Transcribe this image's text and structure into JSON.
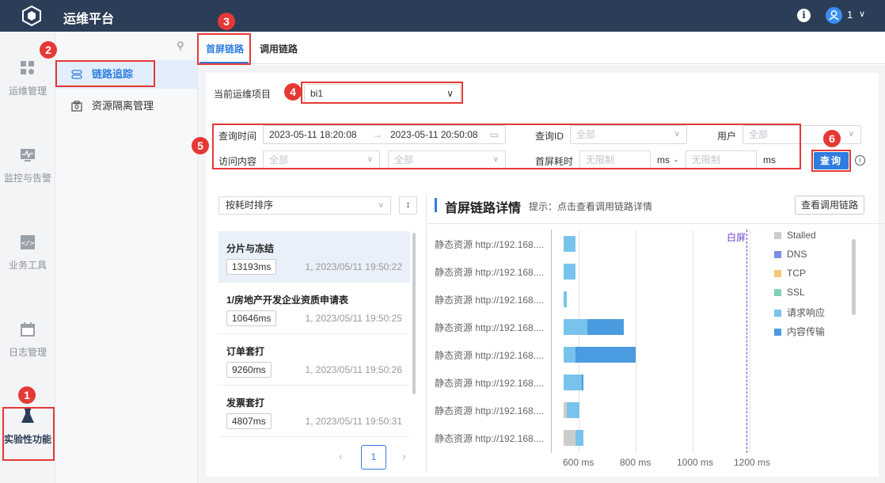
{
  "app": {
    "title": "运维平台",
    "user": "1",
    "info_icon": "info-icon"
  },
  "rail": {
    "items": [
      {
        "label": "运维管理",
        "icon": "grid-icon"
      },
      {
        "label": "监控与告警",
        "icon": "monitor-icon"
      },
      {
        "label": "业务工具",
        "icon": "code-icon"
      },
      {
        "label": "日志管理",
        "icon": "calendar-icon"
      },
      {
        "label": "实验性功能",
        "icon": "flask-icon"
      }
    ]
  },
  "submenu": {
    "items": [
      {
        "label": "链路追踪",
        "active": true
      },
      {
        "label": "资源隔离管理",
        "active": false
      }
    ]
  },
  "tabs": [
    {
      "label": "首屏链路",
      "active": true
    },
    {
      "label": "调用链路",
      "active": false
    }
  ],
  "project": {
    "label": "当前运维项目",
    "value": "bi1"
  },
  "filters": {
    "time_label": "查询时间",
    "time_start": "2023-05-11 18:20:08",
    "time_arrow": "→",
    "time_end": "2023-05-11 20:50:08",
    "id_label": "查询ID",
    "id_value": "全部",
    "user_label": "用户",
    "user_value": "全部",
    "visit_label": "访问内容",
    "visit_value1": "全部",
    "visit_value2": "全部",
    "fst_label": "首屏耗时",
    "fst_min_placeholder": "无限制",
    "fst_max_placeholder": "无限制",
    "unit1": "ms",
    "dash": "-",
    "unit2": "ms",
    "query_button": "查询"
  },
  "badges": [
    "1",
    "2",
    "3",
    "4",
    "5",
    "6"
  ],
  "sort": {
    "label": "按耗时排序"
  },
  "records": [
    {
      "name": "分片与冻结",
      "ms": "13193ms",
      "time": "1, 2023/05/11 19:50:22",
      "selected": true
    },
    {
      "name": "1/房地产开发企业资质申请表",
      "ms": "10646ms",
      "time": "1, 2023/05/11 19:50:25",
      "selected": false
    },
    {
      "name": "订单套打",
      "ms": "9260ms",
      "time": "1, 2023/05/11 19:50:26",
      "selected": false
    },
    {
      "name": "发票套打",
      "ms": "4807ms",
      "time": "1, 2023/05/11 19:50:31",
      "selected": false
    }
  ],
  "pagination": {
    "current": "1",
    "prev": "‹",
    "next": "›"
  },
  "detail": {
    "title": "首屏链路详情",
    "hint": "提示：点击查看调用链路详情",
    "view_button": "查看调用链路",
    "white_screen_label": "白屏",
    "resource_label": "静态资源 http://192.168....",
    "legend": [
      {
        "name": "Stalled",
        "color": "#cccccc"
      },
      {
        "name": "DNS",
        "color": "#7b8fe3"
      },
      {
        "name": "TCP",
        "color": "#f3c77a"
      },
      {
        "name": "SSL",
        "color": "#7fd3b0"
      },
      {
        "name": "请求响应",
        "color": "#78c3ec"
      },
      {
        "name": "内容传输",
        "color": "#4a9be0"
      }
    ],
    "x_ticks": [
      "600 ms",
      "800 ms",
      "1000 ms",
      "1200 ms"
    ]
  },
  "chart_data": {
    "type": "bar",
    "categories": [
      "静态资源 http://192.168....",
      "静态资源 http://192.168....",
      "静态资源 http://192.168....",
      "静态资源 http://192.168....",
      "静态资源 http://192.168....",
      "静态资源 http://192.168....",
      "静态资源 http://192.168....",
      "静态资源 http://192.168...."
    ],
    "x_ticks_ms": [
      600,
      800,
      1000,
      1200
    ],
    "white_screen_ms": 1190,
    "segments": [
      [
        {
          "phase": "请求响应",
          "start": 548,
          "end": 590
        }
      ],
      [
        {
          "phase": "请求响应",
          "start": 548,
          "end": 590
        }
      ],
      [
        {
          "phase": "请求响应",
          "start": 548,
          "end": 558
        }
      ],
      [
        {
          "phase": "请求响应",
          "start": 548,
          "end": 630
        },
        {
          "phase": "内容传输",
          "start": 630,
          "end": 758
        }
      ],
      [
        {
          "phase": "请求响应",
          "start": 548,
          "end": 590
        },
        {
          "phase": "内容传输",
          "start": 590,
          "end": 800
        }
      ],
      [
        {
          "phase": "请求响应",
          "start": 548,
          "end": 611
        },
        {
          "phase": "内容传输",
          "start": 611,
          "end": 614
        }
      ],
      [
        {
          "phase": "Stalled",
          "start": 548,
          "end": 558
        },
        {
          "phase": "请求响应",
          "start": 558,
          "end": 604
        }
      ],
      [
        {
          "phase": "Stalled",
          "start": 548,
          "end": 590
        },
        {
          "phase": "请求响应",
          "start": 590,
          "end": 618
        }
      ]
    ]
  }
}
